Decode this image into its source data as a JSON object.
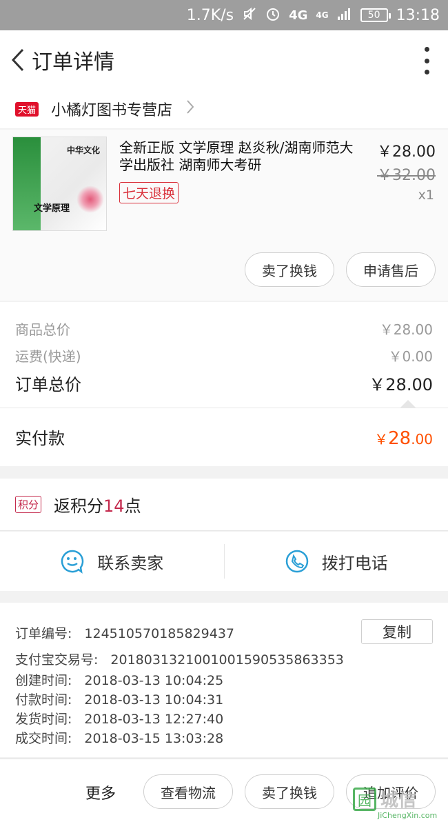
{
  "status_bar": {
    "net_speed": "1.7K/s",
    "network": "4G",
    "network2": "4G",
    "battery": "50",
    "time": "13:18"
  },
  "header": {
    "title": "订单详情"
  },
  "shop": {
    "badge": "天猫",
    "name": "小橘灯图书专营店"
  },
  "product": {
    "title": "全新正版 文学原理 赵炎秋/湖南师范大学出版社 湖南师大考研",
    "tag": "七天退换",
    "price": "￥28.00",
    "original_price": "￥32.00",
    "quantity": "x1",
    "cover_text_1": "中华文化",
    "cover_text_2": "文学原理",
    "buttons": {
      "sell": "卖了换钱",
      "after_sale": "申请售后"
    }
  },
  "summary": {
    "goods_label": "商品总价",
    "goods_value": "￥28.00",
    "shipping_label": "运费(快递)",
    "shipping_value": "￥0.00",
    "total_label": "订单总价",
    "total_value": "￥28.00",
    "paid_label": "实付款",
    "paid_currency": "￥",
    "paid_int": "28",
    "paid_dec": ".00"
  },
  "points": {
    "badge": "积分",
    "prefix": "返积分",
    "value": "14",
    "suffix": "点"
  },
  "contact": {
    "seller": "联系卖家",
    "phone": "拨打电话"
  },
  "order_info": {
    "order_no_label": "订单编号:",
    "order_no": "124510570185829437",
    "alipay_label": "支付宝交易号:",
    "alipay_no": "2018031321001001590535863353",
    "created_label": "创建时间:",
    "created": "2018-03-13 10:04:25",
    "paid_label": "付款时间:",
    "paid": "2018-03-13 10:04:31",
    "shipped_label": "发货时间:",
    "shipped": "2018-03-13 12:27:40",
    "done_label": "成交时间:",
    "done": "2018-03-15 13:03:28",
    "copy": "复制"
  },
  "bottom_bar": {
    "more": "更多",
    "logistics": "查看物流",
    "sell": "卖了换钱",
    "review": "追加评价"
  },
  "watermark": {
    "cn": "城信",
    "en": "JiChengXin.com",
    "icon": "园"
  },
  "colors": {
    "accent_orange": "#ff5000",
    "tmall_red": "#e0102b",
    "points_red": "#c42a4d",
    "contact_blue": "#2a9fd6"
  }
}
